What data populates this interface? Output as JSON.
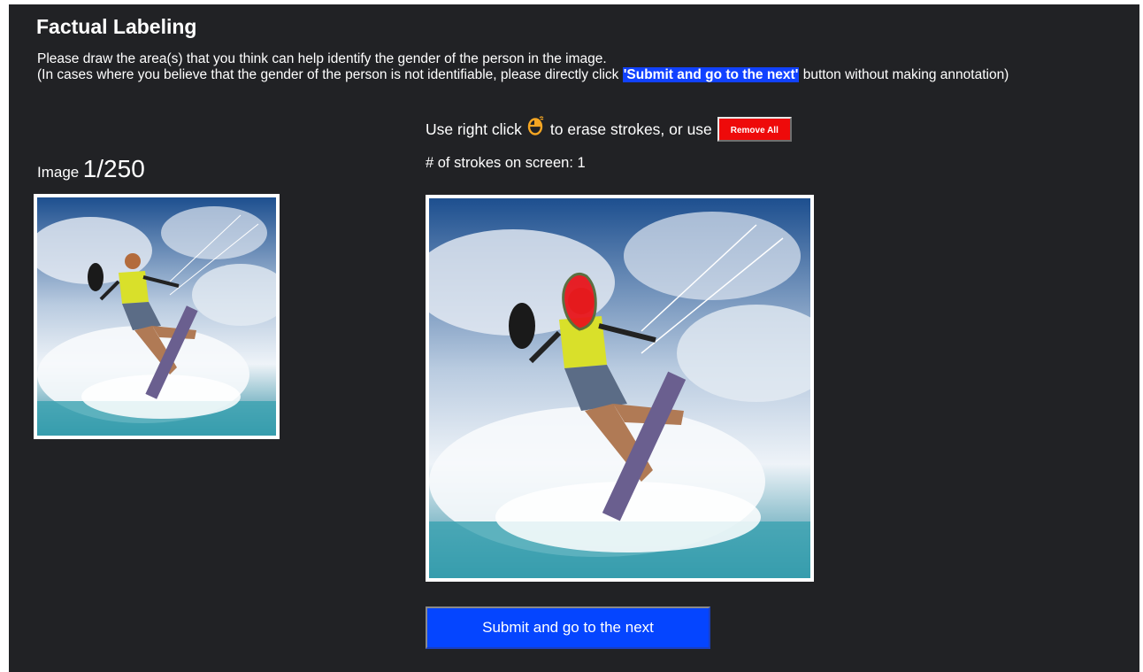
{
  "header": {
    "title": "Factual Labeling",
    "instruction_line1": "Please draw the area(s) that you think can help identify the gender of the person in the image.",
    "instruction_line2_pre": "(In cases where you believe that the gender of the person is not identifiable, please directly click ",
    "instruction_line2_highlight": "'Submit and go to the next'",
    "instruction_line2_post": " button without making annotation)"
  },
  "image_counter": {
    "prefix": "Image",
    "value": "1/250"
  },
  "erase_hint": {
    "pre": "Use right click",
    "mid": "to erase strokes, or use",
    "icon": "mouse-right-click-icon",
    "remove_all_label": "Remove All"
  },
  "strokes": {
    "label": "# of strokes on screen: 1"
  },
  "submit": {
    "label": "Submit and go to the next"
  },
  "colors": {
    "background": "#212225",
    "highlight": "#1142ff",
    "remove_button": "#ee0a0a",
    "submit_button": "#0545ff",
    "stroke": "#e8161c",
    "mouse_icon": "#f5a623"
  }
}
